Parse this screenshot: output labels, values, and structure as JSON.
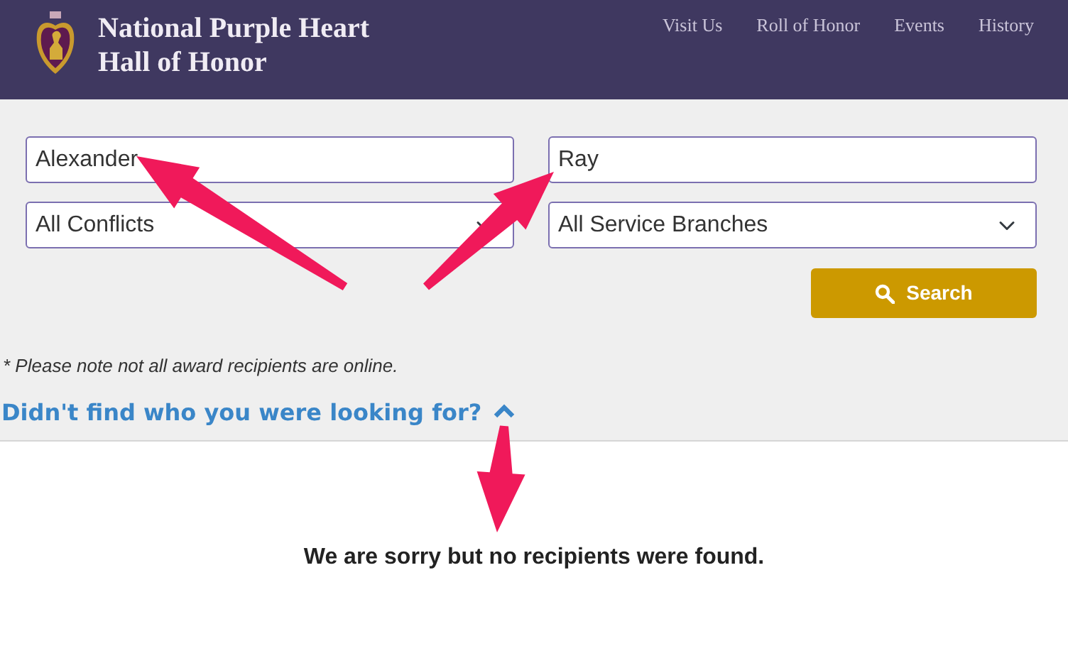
{
  "header": {
    "title_lines": [
      "National Purple Heart",
      "Hall of Honor"
    ],
    "nav": [
      {
        "label": "Visit Us"
      },
      {
        "label": "Roll of Honor"
      },
      {
        "label": "Events"
      },
      {
        "label": "History"
      }
    ]
  },
  "search_form": {
    "first_name": {
      "value": "Alexander"
    },
    "last_name": {
      "value": "Ray"
    },
    "conflict": {
      "value": "All Conflicts"
    },
    "branch": {
      "value": "All Service Branches"
    },
    "button": "Search",
    "note": "* Please note not all award recipients are online.",
    "help_link": {
      "label": "Didn't find who you were looking for?",
      "expanded": true
    }
  },
  "results": {
    "message": "We are sorry but no recipients were found."
  }
}
